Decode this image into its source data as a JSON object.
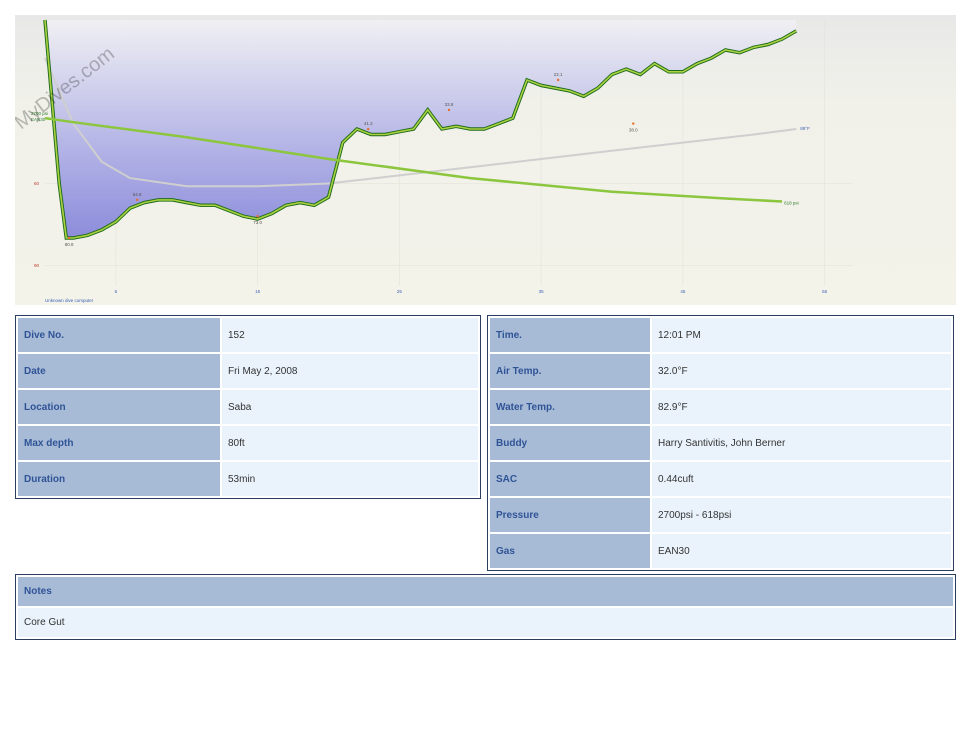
{
  "watermark": "MyDives.com",
  "chart_data": {
    "type": "line",
    "xlim": [
      0,
      57
    ],
    "ylim": [
      102,
      0
    ],
    "x_ticks": [
      5,
      15,
      25,
      35,
      45,
      55
    ],
    "y_ticks": [
      60,
      90
    ],
    "footer_label": "Unknown dive computer",
    "depth_series": {
      "x": [
        0,
        0.5,
        1,
        1.5,
        2,
        3,
        4,
        5,
        6,
        7,
        8,
        9,
        10,
        11,
        12,
        13,
        14,
        15,
        16,
        17,
        18,
        19,
        20,
        21,
        22,
        23,
        24,
        25,
        26,
        27,
        28,
        29,
        30,
        31,
        32,
        33,
        34,
        35,
        36,
        37,
        38,
        39,
        40,
        41,
        42,
        43,
        44,
        45,
        46,
        47,
        48,
        49,
        50,
        51,
        52,
        53
      ],
      "y": [
        0,
        30,
        60,
        80,
        80,
        79,
        77,
        74,
        69,
        67,
        66,
        66,
        67,
        68,
        68,
        70,
        72,
        73,
        71,
        68,
        67,
        68,
        65,
        45,
        40,
        42,
        42,
        41,
        40,
        33,
        40,
        39,
        40,
        40,
        38,
        36,
        22,
        24,
        25,
        26,
        28,
        25,
        20,
        18,
        20,
        16,
        19,
        19,
        16,
        14,
        11,
        12,
        10,
        9,
        7,
        4
      ]
    },
    "pressure_series": {
      "x": [
        0,
        2,
        10,
        20,
        30,
        40,
        48,
        52
      ],
      "y": [
        36,
        37.5,
        43,
        51,
        58,
        63,
        65.5,
        66.6
      ],
      "start_label": "2700 psi",
      "gas_label": "EAN30",
      "end_label": "618 psi"
    },
    "temperature_series": {
      "x": [
        0,
        2,
        4,
        6,
        10,
        15,
        20,
        25,
        30,
        35,
        40,
        45,
        50,
        53
      ],
      "y": [
        14,
        38,
        52,
        58,
        61,
        61,
        60,
        57,
        54,
        51,
        48,
        45,
        42,
        40
      ],
      "end_label": "89°F"
    },
    "markers": [
      {
        "x": 1.7,
        "y": 80,
        "label": "80.8"
      },
      {
        "x": 6.5,
        "y": 66,
        "label": "64.8"
      },
      {
        "x": 15,
        "y": 72,
        "label": "73.0"
      },
      {
        "x": 22.8,
        "y": 40,
        "label": "41.2"
      },
      {
        "x": 28.5,
        "y": 33,
        "label": "33.8"
      },
      {
        "x": 36.2,
        "y": 22,
        "label": "22.1"
      },
      {
        "x": 41.5,
        "y": 38,
        "label": "38.0"
      }
    ]
  },
  "dive_info": [
    {
      "label": "Dive No.",
      "value": "152"
    },
    {
      "label": "Date",
      "value": "Fri May 2, 2008"
    },
    {
      "label": "Location",
      "value": "Saba"
    },
    {
      "label": "Max depth",
      "value": "80ft"
    },
    {
      "label": "Duration",
      "value": "53min"
    }
  ],
  "dive_details": [
    {
      "label": "Time.",
      "value": "12:01 PM"
    },
    {
      "label": "Air Temp.",
      "value": "32.0°F"
    },
    {
      "label": "Water Temp.",
      "value": "82.9°F"
    },
    {
      "label": "Buddy",
      "value": "Harry Santivitis, John Berner"
    },
    {
      "label": "SAC",
      "value": "0.44cuft"
    },
    {
      "label": "Pressure",
      "value": "2700psi - 618psi"
    },
    {
      "label": "Gas",
      "value": "EAN30"
    }
  ],
  "notes": {
    "label": "Notes",
    "value": "Core Gut"
  }
}
